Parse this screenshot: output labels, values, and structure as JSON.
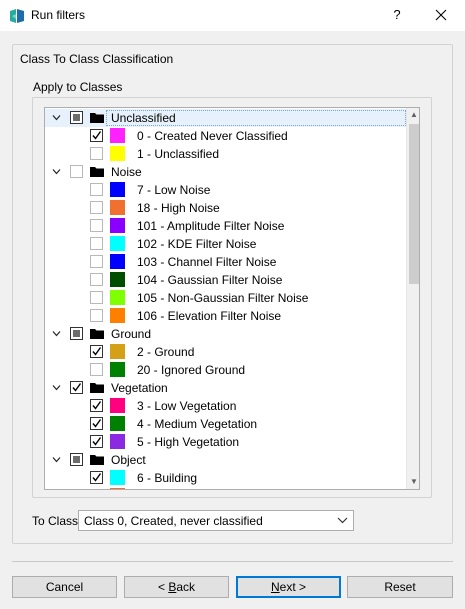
{
  "window": {
    "title": "Run filters",
    "help_glyph": "?",
    "close_glyph": "✕"
  },
  "group": {
    "title": "Class To Class Classification",
    "apply_title": "Apply to Classes"
  },
  "tree": {
    "rows": [
      {
        "kind": "group",
        "label": "Unclassified",
        "state": "partial",
        "selected": true
      },
      {
        "kind": "child",
        "label": "0 - Created Never Classified",
        "checked": true,
        "color": "#ff22ff"
      },
      {
        "kind": "child",
        "label": "1 - Unclassified",
        "checked": false,
        "color": "#ffff00"
      },
      {
        "kind": "group",
        "label": "Noise",
        "state": "unchecked"
      },
      {
        "kind": "child",
        "label": "7 - Low Noise",
        "checked": false,
        "color": "#0000ff"
      },
      {
        "kind": "child",
        "label": "18 - High Noise",
        "checked": false,
        "color": "#f07030"
      },
      {
        "kind": "child",
        "label": "101 - Amplitude Filter Noise",
        "checked": false,
        "color": "#8a00ff"
      },
      {
        "kind": "child",
        "label": "102 - KDE Filter Noise",
        "checked": false,
        "color": "#00ffff"
      },
      {
        "kind": "child",
        "label": "103 - Channel Filter Noise",
        "checked": false,
        "color": "#0000ff"
      },
      {
        "kind": "child",
        "label": "104 - Gaussian Filter Noise",
        "checked": false,
        "color": "#004d00"
      },
      {
        "kind": "child",
        "label": "105 - Non-Gaussian Filter Noise",
        "checked": false,
        "color": "#7fff00"
      },
      {
        "kind": "child",
        "label": "106 - Elevation Filter Noise",
        "checked": false,
        "color": "#ff8000"
      },
      {
        "kind": "group",
        "label": "Ground",
        "state": "partial"
      },
      {
        "kind": "child",
        "label": "2 - Ground",
        "checked": true,
        "color": "#d4a017"
      },
      {
        "kind": "child",
        "label": "20 - Ignored Ground",
        "checked": false,
        "color": "#008000"
      },
      {
        "kind": "group",
        "label": "Vegetation",
        "state": "checked"
      },
      {
        "kind": "child",
        "label": "3 - Low Vegetation",
        "checked": true,
        "color": "#ff007f"
      },
      {
        "kind": "child",
        "label": "4 - Medium Vegetation",
        "checked": true,
        "color": "#008000"
      },
      {
        "kind": "child",
        "label": "5 - High Vegetation",
        "checked": true,
        "color": "#8a2be2"
      },
      {
        "kind": "group",
        "label": "Object",
        "state": "partial"
      },
      {
        "kind": "child",
        "label": "6 - Building",
        "checked": true,
        "color": "#00ffff"
      },
      {
        "kind": "child",
        "label": "",
        "checked": false,
        "color": "#f07030"
      }
    ]
  },
  "to_class": {
    "label": "To Class",
    "value": "Class  0, Created, never classified"
  },
  "buttons": {
    "cancel": "Cancel",
    "back_arrow": "< ",
    "back_key": "B",
    "back_rest": "ack",
    "next_key": "N",
    "next_rest": "ext >",
    "reset": "Reset"
  }
}
